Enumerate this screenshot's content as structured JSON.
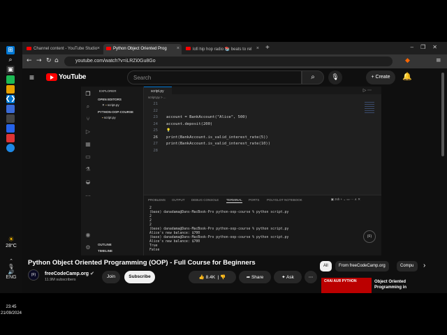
{
  "taskbar": {
    "weather_temp": "28°C",
    "language": "ENG",
    "time": "23:45",
    "date": "21/09/2024"
  },
  "browser": {
    "tabs": [
      {
        "label": "Channel content - YouTube Studio",
        "active": false
      },
      {
        "label": "Python Object Oriented Prog",
        "active": true
      },
      {
        "label": "lofi hip hop radio 📚 beats to rel",
        "active": false
      }
    ],
    "url": "youtube.com/watch?v=iLRZi0Gu8Go"
  },
  "yt_header": {
    "wordmark": "YouTube",
    "search_placeholder": "Search",
    "create_label": "Create"
  },
  "vscode": {
    "sidebar": {
      "explorer_title": "EXPLORER",
      "open_editors": "OPEN EDITORS",
      "open_file": "script.py",
      "folder": "PYTHON-OOP-COURSE",
      "folder_file": "script.py",
      "outline": "OUTLINE",
      "timeline": "TIMELINE"
    },
    "editor_tab": "script.py",
    "breadcrumb": "script.py > ...",
    "code_lines": [
      {
        "num": "21",
        "text": ""
      },
      {
        "num": "22",
        "text": ""
      },
      {
        "num": "23",
        "text": "account = BankAccount(\"Alice\", 500)"
      },
      {
        "num": "24",
        "text": "account.deposit(200)"
      },
      {
        "num": "25",
        "text": ""
      },
      {
        "num": "26",
        "text": "print(BankAccount.is_valid_interest_rate(5))"
      },
      {
        "num": "27",
        "text": "print(BankAccount.is_valid_interest_rate(10))"
      },
      {
        "num": "28",
        "text": ""
      }
    ],
    "panel_tabs": [
      "PROBLEMS",
      "OUTPUT",
      "DEBUG CONSOLE",
      "TERMINAL",
      "PORTS",
      "POLYGLOT NOTEBOOK"
    ],
    "active_panel_tab": "TERMINAL",
    "terminal_shell": "zsh",
    "terminal_lines": [
      "2",
      "(base) danadama@Dans-MacBook-Pro python-oop-course % python script.py",
      "2",
      "2",
      "2",
      "(base) danadama@Dans-MacBook-Pro python-oop-course % python script.py",
      "Alice's new balance: $700",
      "(base) danadama@Dans-MacBook-Pro python-oop-course % python script.py",
      "Alice's new balance: $700",
      "True",
      "False"
    ],
    "badge": "(F)"
  },
  "video_info": {
    "title": "Python Object Oriented Programming (OOP) - Full Course for Beginners",
    "channel": "freeCodeCamp.org",
    "subscribers": "11.9M subscribers",
    "join_label": "Join",
    "subscribe_label": "Subscribe",
    "likes": "8.4K",
    "share_label": "Share",
    "ask_label": "Ask"
  },
  "recommendations": {
    "chips": [
      "All",
      "From freeCodeCamp.org",
      "Compu"
    ],
    "first_video_title": "Object Oriented Programming in",
    "thumb_text": "CHAI AUR PYTHON"
  }
}
